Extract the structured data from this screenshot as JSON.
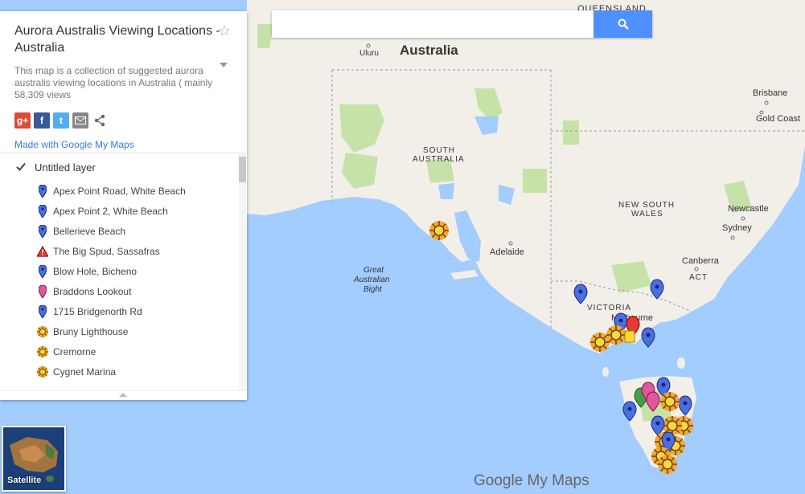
{
  "map": {
    "title": "Aurora Australis Viewing Locations - Australia",
    "description": "This map is a collection of suggested aurora australis viewing locations in Australia ( mainly",
    "views": "58,309 views",
    "made_with": "Made with Google My Maps",
    "brand": "Google My Maps"
  },
  "share": [
    "google-plus-icon",
    "facebook-icon",
    "twitter-icon",
    "email-icon",
    "share-icon"
  ],
  "search": {
    "value": "",
    "placeholder": ""
  },
  "layer": {
    "name": "Untitled layer",
    "checked": true,
    "items": [
      {
        "label": "Apex Point Road, White Beach",
        "icon": "blue-pin-icon"
      },
      {
        "label": "Apex Point 2, White Beach",
        "icon": "blue-pin-icon"
      },
      {
        "label": "Bellerieve Beach",
        "icon": "blue-pin-icon"
      },
      {
        "label": "The Big Spud, Sassafras",
        "icon": "red-warning-icon"
      },
      {
        "label": "Blow Hole, Bicheno",
        "icon": "blue-pin-icon"
      },
      {
        "label": "Braddons Lookout",
        "icon": "pink-pin-icon"
      },
      {
        "label": "1715 Bridgenorth Rd",
        "icon": "blue-pin-icon"
      },
      {
        "label": "Bruny Lighthouse",
        "icon": "sun-icon"
      },
      {
        "label": "Cremorne",
        "icon": "sun-icon"
      },
      {
        "label": "Cygnet Marina",
        "icon": "sun-icon"
      }
    ]
  },
  "satellite_label": "Satellite",
  "map_labels": {
    "queensland": "QUEENSLAND",
    "australia": "Australia",
    "uluru": "Uluru",
    "south": "SOUTH",
    "australia_state": "AUSTRALIA",
    "brisbane": "Brisbane",
    "gold_coast": "Gold Coast",
    "new_south": "NEW SOUTH",
    "wales": "WALES",
    "newcastle": "Newcastle",
    "sydney": "Sydney",
    "adelaide": "Adelaide",
    "canberra": "Canberra",
    "act": "ACT",
    "great": "Great",
    "australian": "Australian",
    "bight": "Bight",
    "victoria": "VICTORIA",
    "melbourne": "Melbourne"
  },
  "colors": {
    "accent": "#4d90fe",
    "link": "#3b78e7",
    "land": "#f2efe9",
    "water": "#a3ccff",
    "park": "#c5e3a8"
  }
}
